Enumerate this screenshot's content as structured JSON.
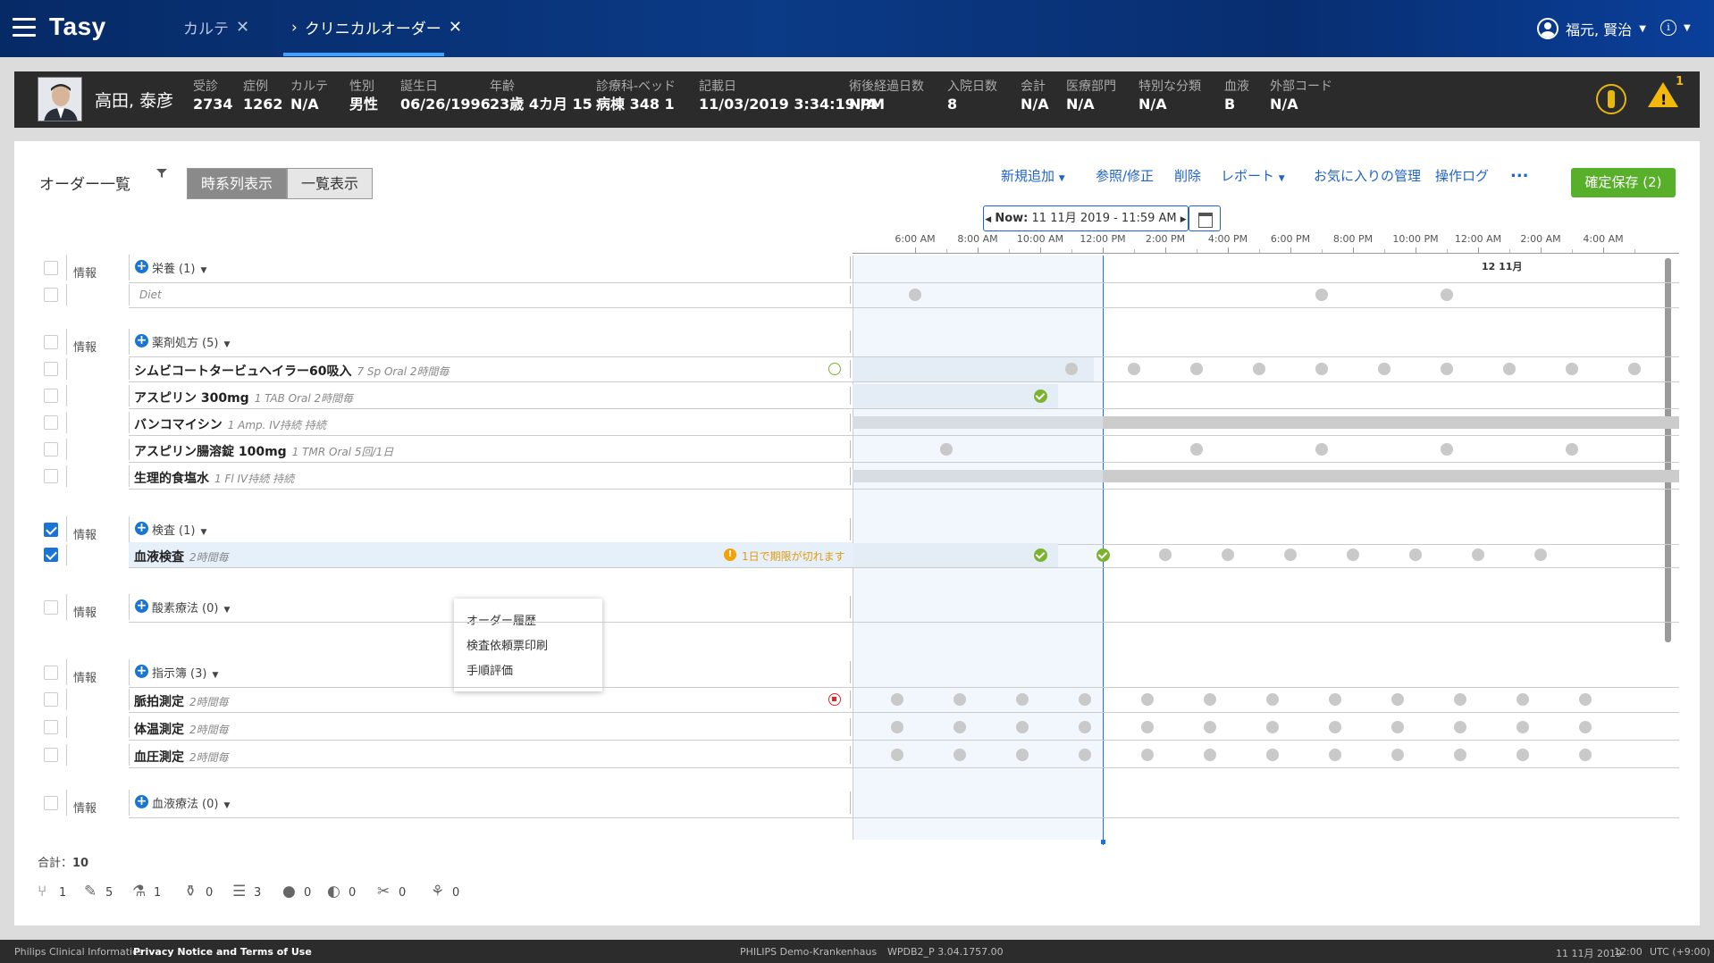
{
  "app": {
    "title": "Tasy"
  },
  "tabs": [
    {
      "label": "カルテ"
    },
    {
      "label": "クリニカルオーダー"
    }
  ],
  "user": {
    "name": "福元, 賢治"
  },
  "patient": {
    "name": "高田, 泰彦",
    "fields": [
      {
        "label": "受診",
        "value": "2734"
      },
      {
        "label": "症例",
        "value": "1262"
      },
      {
        "label": "カルテ",
        "value": "N/A"
      },
      {
        "label": "性別",
        "value": "男性"
      },
      {
        "label": "誕生日",
        "value": "06/26/1996"
      },
      {
        "label": "年齢",
        "value": "23歳 4カ月 15"
      },
      {
        "label": "診療科-ベッド",
        "value": "病棟 348 1"
      },
      {
        "label": "記載日",
        "value": "11/03/2019 3:34:19 PM"
      },
      {
        "label": "術後経過日数",
        "value": "N/A"
      },
      {
        "label": "入院日数",
        "value": "8"
      },
      {
        "label": "会計",
        "value": "N/A"
      },
      {
        "label": "医療部門",
        "value": "N/A"
      },
      {
        "label": "特別な分類",
        "value": "N/A"
      },
      {
        "label": "血液",
        "value": "B"
      },
      {
        "label": "外部コード",
        "value": "N/A"
      }
    ],
    "alert_count": "1"
  },
  "toolbar": {
    "title": "オーダー一覧",
    "view_timeline": "時系列表示",
    "view_list": "一覧表示",
    "actions": [
      "新規追加",
      "参照/修正",
      "削除",
      "レポート",
      "お気に入りの管理",
      "操作ログ"
    ],
    "more": "...",
    "save": "確定保存 (2)"
  },
  "timeline": {
    "now_prefix": "Now:",
    "now_value": "11 11月 2019 - 11:59 AM",
    "hours": [
      "6:00 AM",
      "8:00 AM",
      "10:00 AM",
      "12:00 PM",
      "2:00 PM",
      "4:00 PM",
      "6:00 PM",
      "8:00 PM",
      "10:00 PM",
      "12:00 AM",
      "2:00 AM",
      "4:00 AM"
    ],
    "date_label": "12 11月"
  },
  "groups": [
    {
      "info": "情報",
      "name": "栄養",
      "count": "(1)",
      "items": [
        {
          "name": "",
          "detail": "Diet"
        }
      ]
    },
    {
      "info": "情報",
      "name": "薬剤処方",
      "count": "(5)",
      "items": [
        {
          "name": "シムビコートタービュヘイラー60吸入",
          "detail": "7 Sp Oral 2時間毎"
        },
        {
          "name": "アスピリン 300mg",
          "detail": "1 TAB Oral 2時間毎"
        },
        {
          "name": "バンコマイシン",
          "detail": "1 Amp. IV持続 持続"
        },
        {
          "name": "アスピリン腸溶錠 100mg",
          "detail": "1 TMR Oral 5回/1日"
        },
        {
          "name": "生理的食塩水",
          "detail": "1 Fl IV持続 持続"
        }
      ]
    },
    {
      "info": "情報",
      "name": "検査",
      "count": "(1)",
      "items": [
        {
          "name": "血液検査",
          "detail": "2時間毎",
          "warning": "1日で期限が切れます"
        }
      ]
    },
    {
      "info": "情報",
      "name": "酸素療法",
      "count": "(0)",
      "items": []
    },
    {
      "info": "情報",
      "name": "指示簿",
      "count": "(3)",
      "items": [
        {
          "name": "脈拍測定",
          "detail": "2時間毎"
        },
        {
          "name": "体温測定",
          "detail": "2時間毎"
        },
        {
          "name": "血圧測定",
          "detail": "2時間毎"
        }
      ]
    },
    {
      "info": "情報",
      "name": "血液療法",
      "count": "(0)",
      "items": []
    }
  ],
  "context_menu": [
    "オーダー履歴",
    "検査依頼票印刷",
    "手順評価"
  ],
  "summary": {
    "total_label": "合計：",
    "total": "10",
    "icons": [
      {
        "icon": "meal-icon",
        "count": "1"
      },
      {
        "icon": "syringe-icon",
        "count": "5"
      },
      {
        "icon": "lab-icon",
        "count": "1"
      },
      {
        "icon": "oxygen-icon",
        "count": "0"
      },
      {
        "icon": "list-icon",
        "count": "3"
      },
      {
        "icon": "blood-icon",
        "count": "0"
      },
      {
        "icon": "radiation-icon",
        "count": "0"
      },
      {
        "icon": "procedure-icon",
        "count": "0"
      },
      {
        "icon": "recovery-icon",
        "count": "0"
      }
    ]
  },
  "footer": {
    "company": "Philips Clinical Informatics",
    "privacy": "Privacy Notice and Terms of Use",
    "site": "PHILIPS Demo-Krankenhaus",
    "build": "WPDB2_P 3.04.1757.00",
    "date": "11 11月 2019",
    "time": "12:00",
    "tz": "UTC (+9:00)"
  }
}
